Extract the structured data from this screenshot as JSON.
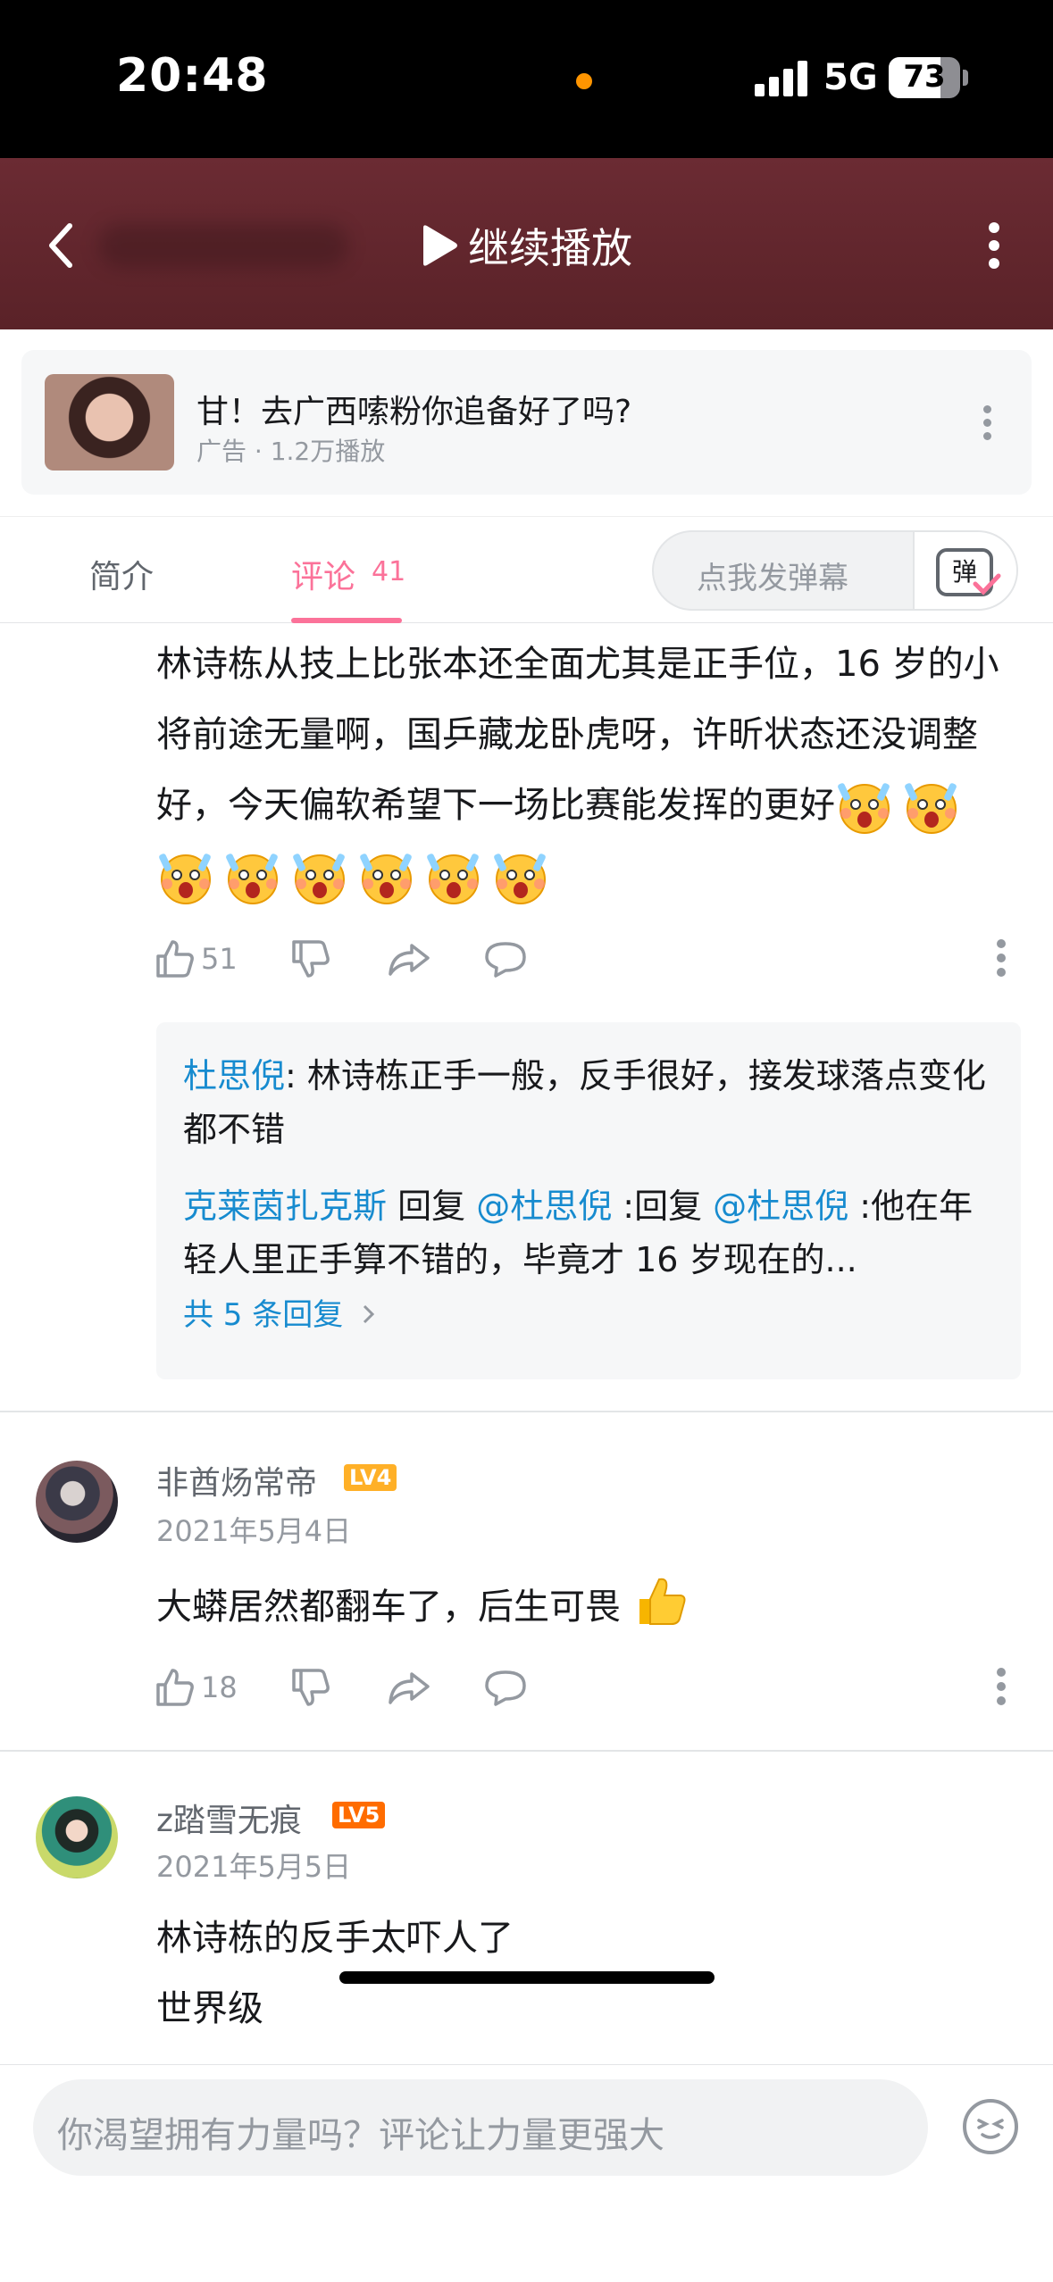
{
  "status": {
    "time": "20:48",
    "network": "5G",
    "battery": "73",
    "battery_level": 0.73
  },
  "video": {
    "resume_label": "继续播放"
  },
  "ad": {
    "title": "甘！去广西嗦粉你追备好了吗?",
    "meta": "广告 · 1.2万播放"
  },
  "tabs": {
    "intro": "简介",
    "comments": "评论",
    "comment_count": "41"
  },
  "danmu": {
    "placeholder": "点我发弹幕",
    "button": "弹"
  },
  "comment1": {
    "text": "林诗栋从技上比张本还全面尤其是正手位，16 岁的小将前途无量啊，国乒藏龙卧虎呀，许昕状态还没调整好，今天偏软希望下一场比赛能发挥的更好",
    "emoji_count": 8,
    "likes": "51"
  },
  "replies": {
    "r1_user": "杜思倪",
    "r1_sep": ": ",
    "r1_text": "林诗栋正手一般，反手很好，接发球落点变化都不错",
    "r2_user": "克莱茵扎克斯",
    "r2_reply": " 回复 ",
    "r2_at1": "@杜思倪",
    "r2_mid": " :回复 ",
    "r2_at2": "@杜思倪",
    "r2_text": " :他在年轻人里正手算不错的，毕竟才 16 岁现在的...",
    "total": "共 5 条回复"
  },
  "comment2": {
    "user": "非酋炀常帝",
    "level": "LV4",
    "level_color": "#ffb027",
    "date": "2021年5月4日",
    "text": "大蟒居然都翻车了，后生可畏",
    "likes": "18"
  },
  "comment3": {
    "user": "z踏雪无痕",
    "level": "LV5",
    "level_color": "#ff6c00",
    "date": "2021年5月5日",
    "line1": "林诗栋的反手太吓人了",
    "line2": "世界级"
  },
  "composer": {
    "placeholder": "你渴望拥有力量吗？评论让力量更强大"
  },
  "colors": {
    "accent": "#fb7299",
    "link": "#178bcf",
    "header": "#5e252b"
  },
  "icons": [
    "back-icon",
    "play-icon",
    "more-vertical-icon",
    "like-icon",
    "dislike-icon",
    "share-icon",
    "reply-icon",
    "thumbs-up-emoji",
    "scream-emoji",
    "emoticon-icon"
  ]
}
